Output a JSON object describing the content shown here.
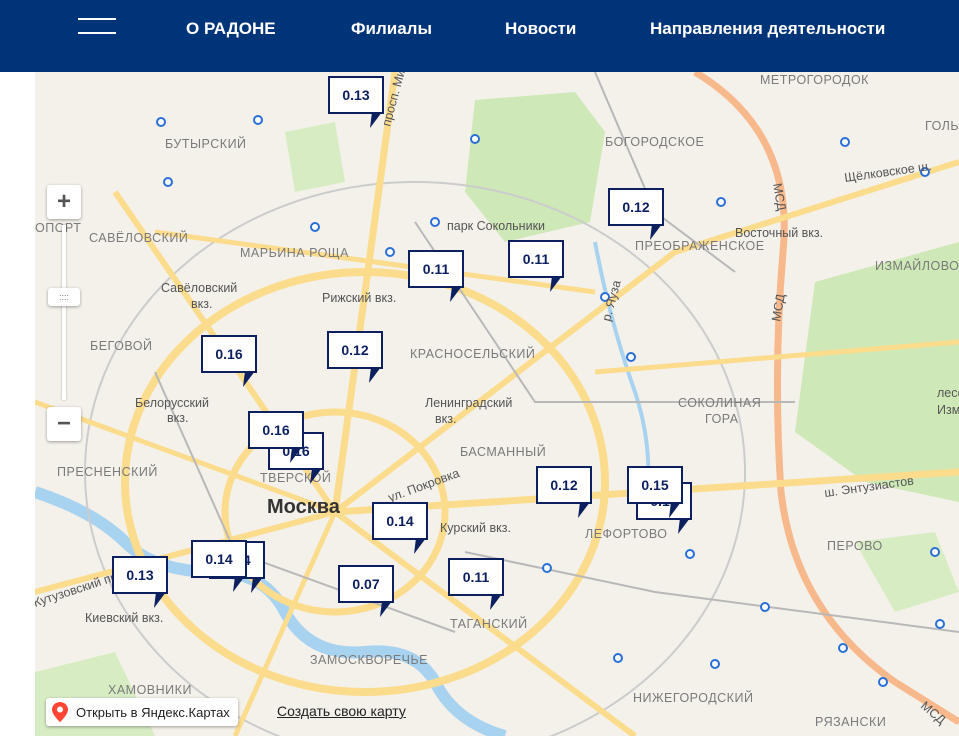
{
  "header": {
    "nav": [
      "О РАДОНЕ",
      "Филиалы",
      "Новости",
      "Направления деятельности"
    ]
  },
  "map": {
    "city_label": "Москва",
    "labels": [
      "МЕТРОГОРОДОК",
      "БУТЫРСКИЙ",
      "БОГОРОДСКОЕ",
      "ГОЛЬ",
      "Щёлковское ш.",
      "парк Сокольники",
      "ОПОРТ",
      "САВЁЛОВСКИЙ",
      "МАРЬИНА РОЩА",
      "Восточный вкз.",
      "ПРЕОБРАЖЕНСКОЕ",
      "ИЗМАЙЛОВО",
      "Савёловский",
      "вкз.",
      "Рижский вкз.",
      "р. Яуза",
      "БЕГОВОЙ",
      "КРАСНОСЕЛЬСКИЙ",
      "лесопа",
      "Измай",
      "Белорусский",
      "вкз.",
      "Ленинградский",
      "вкз.",
      "СОКОЛИНАЯ",
      "ГОРА",
      "ПРЕСНЕНСКИЙ",
      "БАСМАННЫЙ",
      "ТВЕРСКОЙ",
      "ш. Энтузиастов",
      "Курский вкз.",
      "ЛЕФОРТОВО",
      "ПЕРОВО",
      "ул. Покровка",
      "Киевский вкз.",
      "ТАГАНСКИЙ",
      "ЗАМОСКВОРЕЧЬЕ",
      "ХАМОВНИКИ",
      "НИЖЕГОРОДСКИЙ",
      "РЯЗАНСКИ",
      "МСД",
      "просп. Мира",
      "Кутузовский просп."
    ],
    "markers": [
      "0.13",
      "0.12",
      "0.11",
      "0.11",
      "0.16",
      "0.12",
      "0.16",
      "0.16",
      "0.12",
      "0.15",
      "0.15",
      "0.14",
      "0.14",
      "0.14",
      "0.13",
      "0.07",
      "0.11"
    ],
    "zoom": {
      "plus": "+",
      "minus": "−",
      "handle": "::::"
    },
    "open_yandex": "Открыть в Яндекс.Картах",
    "create_map": "Создать свою карту"
  },
  "colors": {
    "header_bg": "#003478",
    "marker_border": "#0c1f5f",
    "park": "#cfe8b8",
    "road": "#fbdc8c",
    "water": "#a8d3f0"
  }
}
